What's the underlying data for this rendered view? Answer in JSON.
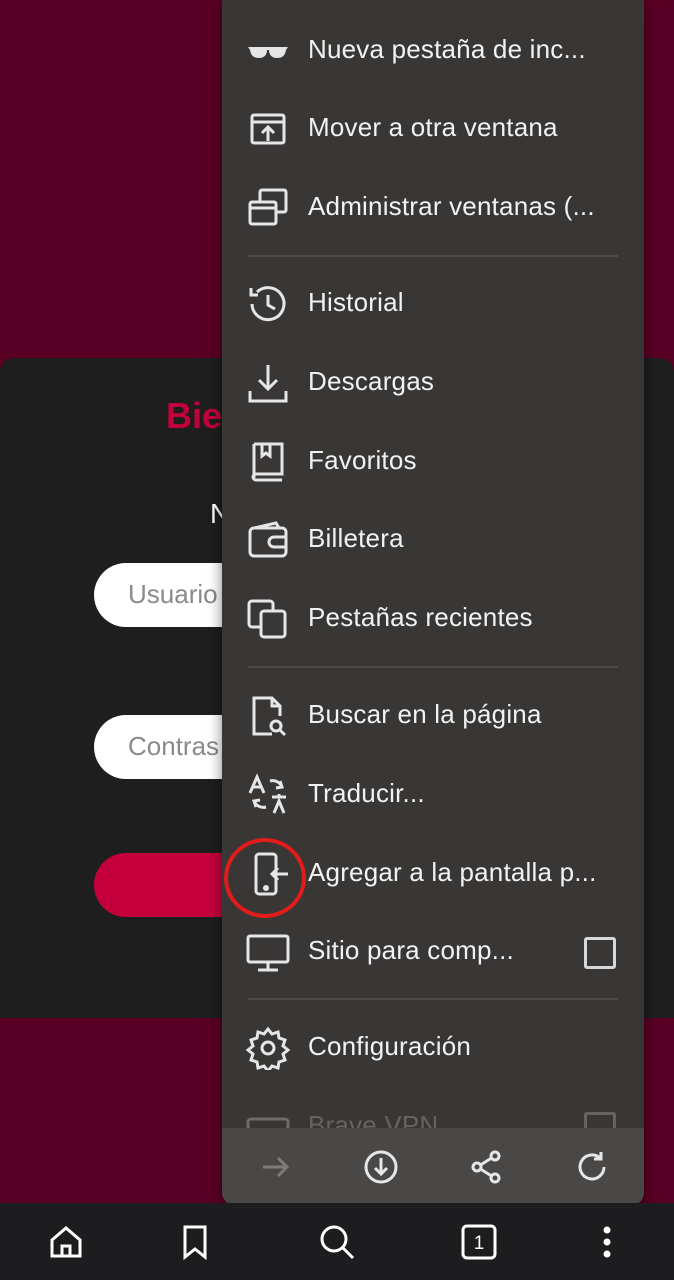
{
  "page": {
    "welcome_partial": "Bie",
    "sub_partial": "N",
    "username_placeholder": "Usuario",
    "password_placeholder": "Contras"
  },
  "menu": {
    "items": [
      {
        "label": "Nueva pestaña de inc...",
        "icon": "incognito-glasses-icon"
      },
      {
        "label": "Mover a otra ventana",
        "icon": "move-window-icon"
      },
      {
        "label": "Administrar ventanas (...",
        "icon": "manage-windows-icon"
      },
      {
        "label": "Historial",
        "icon": "history-icon"
      },
      {
        "label": "Descargas",
        "icon": "download-icon"
      },
      {
        "label": "Favoritos",
        "icon": "bookmarks-book-icon"
      },
      {
        "label": "Billetera",
        "icon": "wallet-icon"
      },
      {
        "label": "Pestañas recientes",
        "icon": "recent-tabs-icon"
      },
      {
        "label": "Buscar en la página",
        "icon": "find-in-page-icon"
      },
      {
        "label": "Traducir...",
        "icon": "translate-icon"
      },
      {
        "label": "Agregar a la pantalla p...",
        "icon": "add-to-home-screen-icon"
      },
      {
        "label": "Sitio para comp...",
        "icon": "desktop-monitor-icon"
      },
      {
        "label": "Configuración",
        "icon": "settings-gear-icon"
      },
      {
        "label": "Brave VPN",
        "icon": "vpn-icon"
      }
    ],
    "desktop_site_checked": false,
    "vpn_checked": false,
    "bottom_actions": [
      "forward-arrow-icon",
      "download-circle-icon",
      "share-icon",
      "reload-icon"
    ]
  },
  "toolbar": {
    "tab_count": "1",
    "icons": [
      "home-icon",
      "bookmark-icon",
      "search-icon",
      "tab-counter-icon",
      "more-vert-icon"
    ]
  },
  "colors": {
    "background": "#5a0024",
    "accent": "#c4003c",
    "menu_bg": "#393735",
    "highlight_circle": "#e21b1b"
  }
}
